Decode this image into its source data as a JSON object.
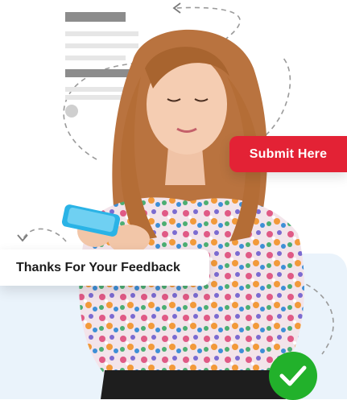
{
  "cta": {
    "label": "Submit Here"
  },
  "feedback": {
    "message": "Thanks For Your Feedback"
  },
  "colors": {
    "accent": "#e32235",
    "success": "#22b12b",
    "panel": "#eaf3fb",
    "phone": "#2ab3e6"
  },
  "icons": {
    "check": "check-icon",
    "arrows": "dashed-arrow-icon"
  }
}
